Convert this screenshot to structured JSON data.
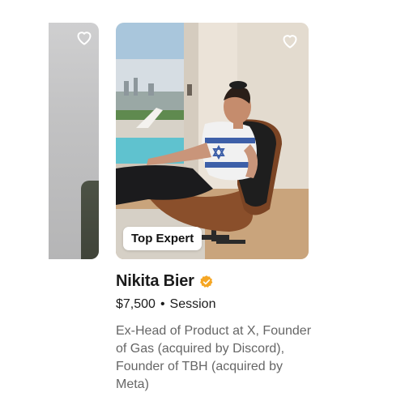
{
  "icons": {
    "favorite": "heart-outline-icon",
    "verified": "verified-check-badge-icon"
  },
  "colors": {
    "verified_badge": "#F5A623",
    "name_text": "#1B1B1B",
    "bio_text": "#666666"
  },
  "expert": {
    "badge": "Top Expert",
    "name": "Nikita Bier",
    "price": "$7,500",
    "separator": "•",
    "unit": "Session",
    "bio": "Ex-Head of Product at X, Founder of Gas (acquired by Discord), Founder of TBH (acquired by Meta)"
  }
}
